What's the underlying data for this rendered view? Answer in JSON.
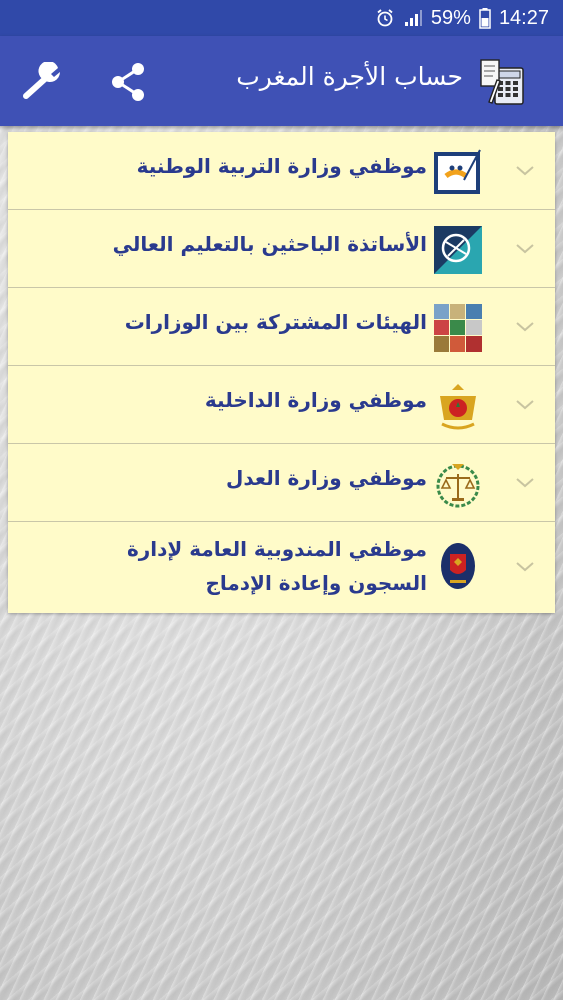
{
  "status_bar": {
    "battery_percent": "59%",
    "time": "14:27",
    "icons": [
      "alarm-icon",
      "signal-icon",
      "battery-icon"
    ]
  },
  "app_bar": {
    "title": "حساب الأجرة المغرب",
    "icons": [
      "wrench-icon",
      "share-icon",
      "calculator-logo-icon"
    ]
  },
  "categories": [
    {
      "label": "موظفي وزارة التربية الوطنية"
    },
    {
      "label": "الأساتذة الباحثين بالتعليم العالي"
    },
    {
      "label": "الهيئات المشتركة بين الوزارات"
    },
    {
      "label": "موظفي وزارة الداخلية"
    },
    {
      "label": "موظفي وزارة العدل"
    },
    {
      "label": "موظفي المندوبية العامة لإدارة السجون وإعادة الإدماج"
    }
  ],
  "colors": {
    "status_bar": "#3049a9",
    "app_bar": "#3f51b5",
    "list_background": "#fffbc9",
    "label_text": "#2a3a8e"
  }
}
